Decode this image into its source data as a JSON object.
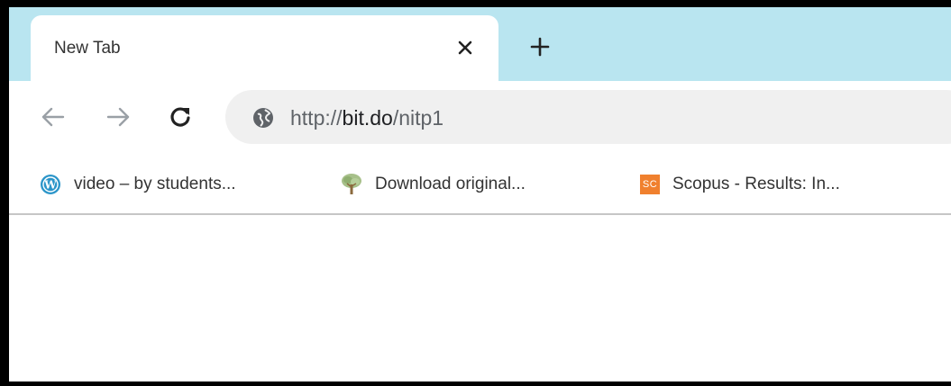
{
  "tab": {
    "title": "New Tab"
  },
  "address_bar": {
    "url_prefix": "http://",
    "url_host": "bit.do",
    "url_path": "/nitp1"
  },
  "bookmarks": [
    {
      "label": "video – by students...",
      "icon": "wordpress-icon"
    },
    {
      "label": "Download original...",
      "icon": "tree-icon"
    },
    {
      "label": "Scopus - Results: In...",
      "icon": "scopus-icon",
      "icon_text": "SC"
    }
  ],
  "colors": {
    "tabstrip": "#b9e5f0",
    "omnibox": "#f0f0f0",
    "wordpress": "#2b95c9",
    "scopus": "#f0802e"
  }
}
